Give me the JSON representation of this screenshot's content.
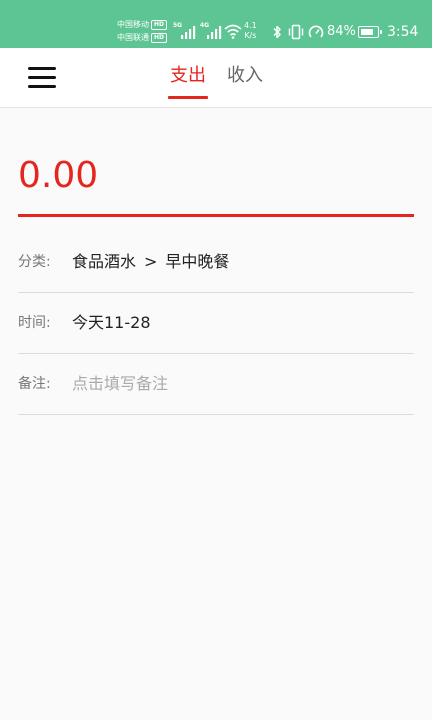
{
  "status_bar": {
    "carrier_1": "中国移动",
    "carrier_2": "中国联通",
    "hd_badge": "HD",
    "net_tag_1": "5G",
    "net_tag_2": "4G",
    "speed_value": "4.1",
    "speed_unit": "K/s",
    "battery_percent": "84%",
    "battery_level": 0.84,
    "time": "3:54",
    "background_color": "#5cc593"
  },
  "header": {
    "tabs": [
      {
        "label": "支出",
        "selected": true
      },
      {
        "label": "收入",
        "selected": false
      }
    ],
    "accent_color": "#e5251e"
  },
  "form": {
    "amount": "0.00",
    "category": {
      "label": "分类:",
      "primary": "食品酒水",
      "separator": ">",
      "secondary": "早中晚餐"
    },
    "time": {
      "label": "时间:",
      "value": "今天11-28"
    },
    "note": {
      "label": "备注:",
      "placeholder": "点击填写备注"
    }
  }
}
